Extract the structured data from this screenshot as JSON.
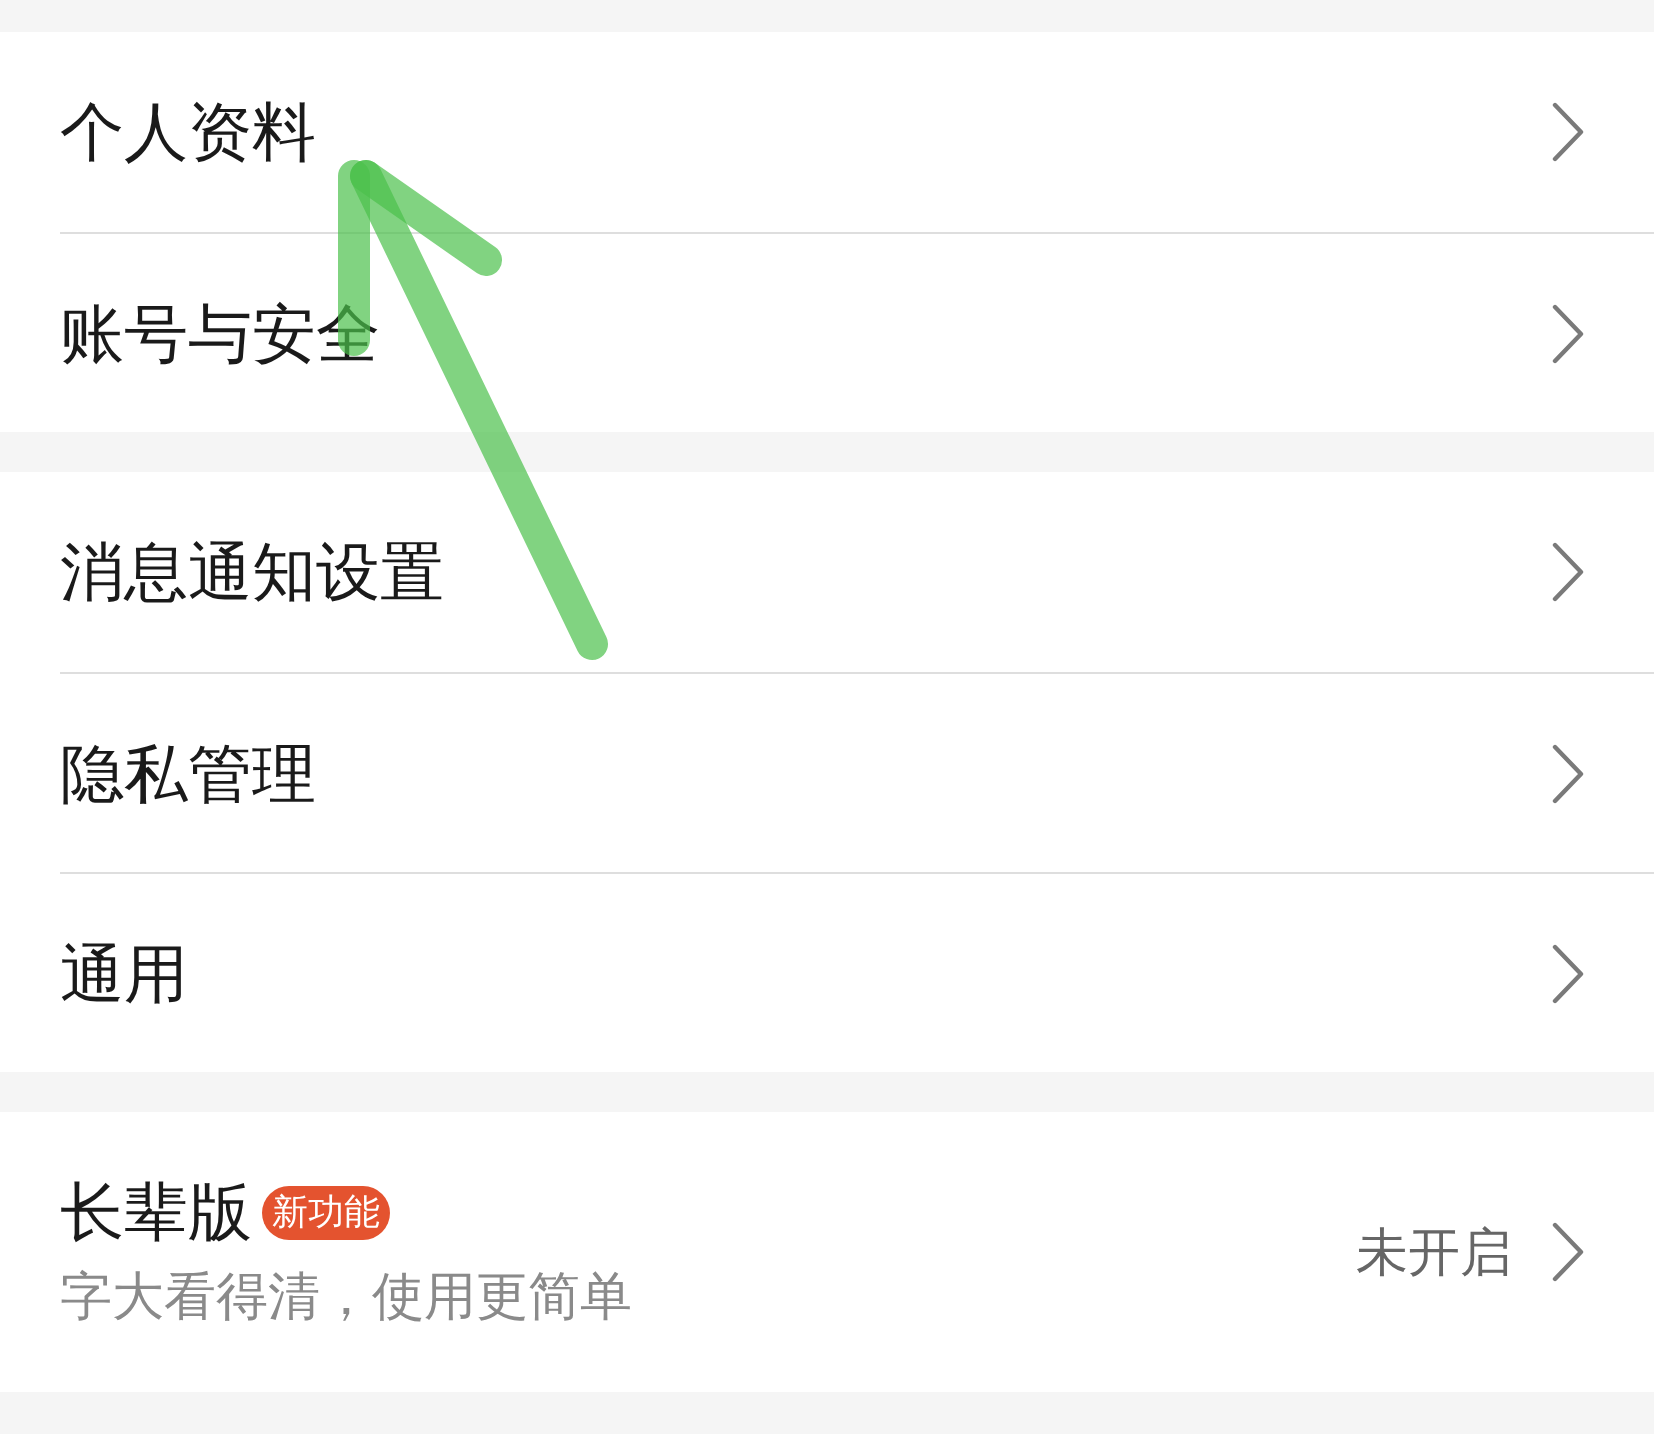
{
  "groups": [
    {
      "items": [
        {
          "label": "个人资料"
        },
        {
          "label": "账号与安全"
        }
      ]
    },
    {
      "items": [
        {
          "label": "消息通知设置"
        },
        {
          "label": "隐私管理"
        },
        {
          "label": "通用"
        }
      ]
    },
    {
      "items": [
        {
          "label": "长辈版",
          "badge": "新功能",
          "subtitle": "字大看得清，使用更简单",
          "value": "未开启"
        }
      ]
    }
  ]
}
